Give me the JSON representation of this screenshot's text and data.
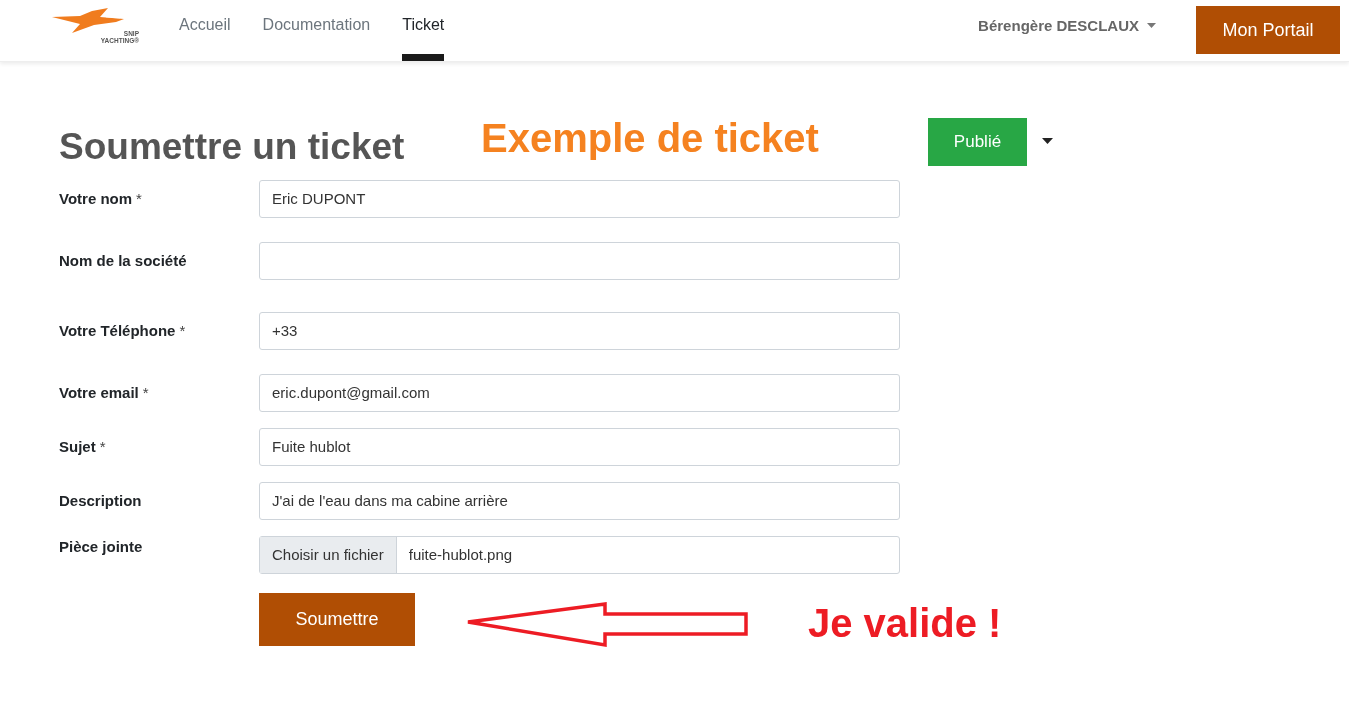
{
  "header": {
    "logo": {
      "line_1": "SNIP",
      "line_2": "YACHTING®"
    },
    "nav": [
      {
        "label": "Accueil",
        "selected": false
      },
      {
        "label": "Documentation",
        "selected": false
      },
      {
        "label": "Ticket",
        "selected": true
      }
    ],
    "user_menu": "Bérengère DESCLAUX",
    "portal_button": "Mon Portail"
  },
  "page": {
    "title": "Soumettre un ticket",
    "annotation_title": "Exemple de ticket",
    "status_button": "Publié"
  },
  "form": {
    "fields": [
      {
        "kind": "text",
        "label": "Votre nom",
        "required_mark": "*",
        "value": "Eric DUPONT"
      },
      {
        "kind": "text",
        "label": "Nom de la société"
      },
      {
        "kind": "text",
        "label": "Votre Téléphone",
        "required_mark": "*",
        "value": "+33"
      },
      {
        "kind": "text",
        "label": "Votre email",
        "required_mark": "*",
        "value": "eric.dupont@gmail.com"
      },
      {
        "kind": "text",
        "label": "Sujet",
        "required_mark": "*",
        "value": "Fuite hublot"
      },
      {
        "kind": "text",
        "label": "Description",
        "value": "J'ai de l'eau dans ma cabine arrière"
      },
      {
        "kind": "file",
        "label": "Pièce jointe",
        "button": "Choisir un fichier",
        "value": "fuite-hublot.png"
      }
    ],
    "submit": "Soumettre",
    "annotation": "Je valide !"
  }
}
